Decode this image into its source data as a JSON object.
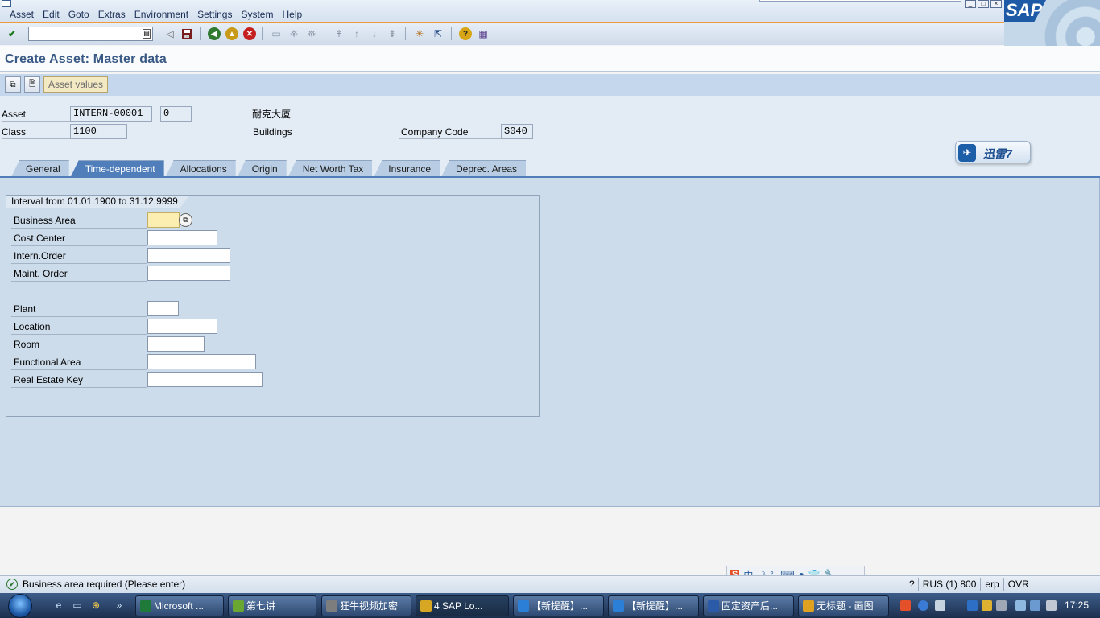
{
  "menu": [
    "Asset",
    "Edit",
    "Goto",
    "Extras",
    "Environment",
    "Settings",
    "System",
    "Help"
  ],
  "window_buttons": [
    "_",
    "□",
    "×"
  ],
  "logo": "SAP",
  "toolbar": {
    "command_value": "",
    "icons": [
      "enter-icon",
      "back-arrow-icon",
      "save-icon",
      "back-icon",
      "exit-icon",
      "cancel-icon",
      "print-icon",
      "find-icon",
      "find-next-icon",
      "first-page-icon",
      "previous-page-icon",
      "next-page-icon",
      "last-page-icon",
      "new-session-icon",
      "shortcut-icon",
      "help-icon",
      "layout-menu-icon"
    ]
  },
  "title": "Create Asset:  Master data",
  "app_toolbar": {
    "asset_values_label": "Asset values"
  },
  "header": {
    "asset_label": "Asset",
    "asset_number": "INTERN-00001",
    "asset_subnumber": "0",
    "asset_description": "耐克大厦",
    "class_label": "Class",
    "class_value": "1100",
    "class_description": "Buildings",
    "company_code_label": "Company Code",
    "company_code_value": "S040"
  },
  "xunlei_badge": "迅雷7",
  "tabs": [
    "General",
    "Time-dependent",
    "Allocations",
    "Origin",
    "Net Worth Tax",
    "Insurance",
    "Deprec. Areas"
  ],
  "active_tab": "Time-dependent",
  "group": {
    "title": "Interval from 01.01.1900 to 31.12.9999",
    "fields": [
      {
        "label": "Business Area",
        "value": "",
        "required": true
      },
      {
        "label": "Cost Center",
        "value": ""
      },
      {
        "label": "Intern.Order",
        "value": ""
      },
      {
        "label": "Maint. Order",
        "value": ""
      },
      {
        "label": "Plant",
        "value": ""
      },
      {
        "label": "Location",
        "value": ""
      },
      {
        "label": "Room",
        "value": ""
      },
      {
        "label": "Functional Area",
        "value": ""
      },
      {
        "label": "Real Estate Key",
        "value": ""
      }
    ]
  },
  "status": {
    "message": "Business area required (Please enter)",
    "system": "RUS (1) 800",
    "server": "erp",
    "mode": "OVR"
  },
  "ime_bar": [
    "S",
    "中",
    "☽",
    "°,",
    "⌨",
    "●",
    "👕",
    "🔧"
  ],
  "taskbar": {
    "items": [
      "Microsoft ...",
      "第七讲",
      "狂牛视频加密",
      "4 SAP Lo...",
      "【新提醒】...",
      "【新提醒】...",
      "固定资产后...",
      "无标题 - 画图"
    ],
    "active_index": 3,
    "clock": "17:25"
  },
  "colors": {
    "tab_active": "#4f7ebb",
    "required_field": "#fbeeb0",
    "title_text": "#3a5a86"
  }
}
